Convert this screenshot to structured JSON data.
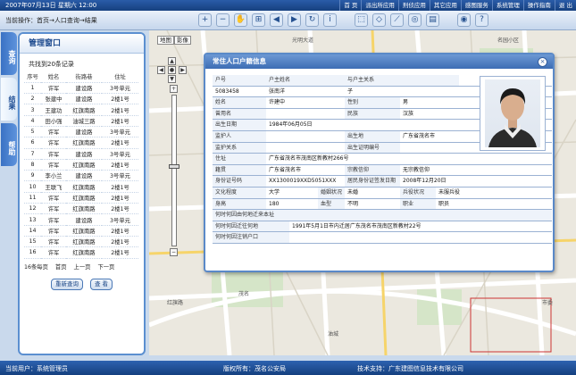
{
  "topbar": {
    "date": "2007年07月13日 星期六 12:00",
    "nav": [
      "首 页",
      "派出所应用",
      "刑侦应用",
      "其它应用",
      "感图服务",
      "系统管理",
      "操作指南",
      "退 出"
    ]
  },
  "toolbar": {
    "crumb": "当前操作：首页→人口查询→结果",
    "tools": [
      "zoom-in-icon",
      "zoom-out-icon",
      "pan-hand-icon",
      "full-extent-icon",
      "back-icon",
      "forward-icon",
      "refresh-icon",
      "info-icon",
      "select-icon",
      "erase-icon",
      "measure-icon",
      "locate-icon",
      "print-icon",
      "globe-icon",
      "help-icon"
    ]
  },
  "vtabs": [
    "查询",
    "结果",
    "帮助"
  ],
  "panel": {
    "title": "管理窗口",
    "count": "共找到20条记录",
    "columns": [
      "序号",
      "姓名",
      "街路巷",
      "住址"
    ],
    "rows": [
      [
        "1",
        "许军",
        "建设路",
        "3号单元"
      ],
      [
        "2",
        "张建中",
        "建设路",
        "2楼1号"
      ],
      [
        "3",
        "王建功",
        "红旗南路",
        "2楼1号"
      ],
      [
        "4",
        "田小强",
        "油城三路",
        "2楼1号"
      ],
      [
        "5",
        "许军",
        "建设路",
        "3号单元"
      ],
      [
        "6",
        "许军",
        "红旗南路",
        "2楼1号"
      ],
      [
        "7",
        "许军",
        "建设路",
        "3号单元"
      ],
      [
        "8",
        "许军",
        "红旗南路",
        "2楼1号"
      ],
      [
        "9",
        "李小兰",
        "建设路",
        "3号单元"
      ],
      [
        "10",
        "王联飞",
        "红旗南路",
        "2楼1号"
      ],
      [
        "11",
        "许军",
        "红旗南路",
        "2楼1号"
      ],
      [
        "12",
        "许军",
        "红旗南路",
        "2楼1号"
      ],
      [
        "13",
        "许军",
        "建设路",
        "3号单元"
      ],
      [
        "14",
        "许军",
        "红旗南路",
        "2楼1号"
      ],
      [
        "15",
        "许军",
        "红旗南路",
        "2楼1号"
      ],
      [
        "16",
        "许军",
        "红旗南路",
        "2楼1号"
      ]
    ],
    "pager": [
      "16条每页",
      "首页",
      "上一页",
      "下一页"
    ],
    "buttons": [
      "重新查询",
      "查 看"
    ]
  },
  "map": {
    "view_tabs": [
      "地图",
      "影像"
    ],
    "labels": [
      "光明大道",
      "名园小区",
      "红旗路",
      "油城",
      "市委",
      "茂名"
    ]
  },
  "popup": {
    "title": "常住人口户籍信息",
    "close": "×",
    "rows": [
      [
        [
          "户号",
          "label",
          60
        ],
        [
          "户主姓名",
          "label",
          88
        ],
        [
          "与户主关系",
          "label",
          128
        ]
      ],
      [
        [
          "5083458",
          "val",
          60
        ],
        [
          "张南洋",
          "val",
          88
        ],
        [
          "子",
          "val",
          128
        ]
      ],
      [
        [
          "姓名",
          "label",
          60
        ],
        [
          "许建中",
          "val",
          88
        ],
        [
          "性别",
          "label",
          62
        ],
        [
          "男",
          "val",
          66
        ]
      ],
      [
        [
          "曾用名",
          "label",
          60
        ],
        [
          "",
          "val",
          88
        ],
        [
          "民族",
          "label",
          62
        ],
        [
          "汉族",
          "val",
          66
        ]
      ],
      [
        [
          "出生日期",
          "label",
          60
        ],
        [
          "1984年06月05日",
          "val",
          216
        ]
      ],
      [
        [
          "监护人",
          "label",
          60
        ],
        [
          "",
          "val",
          88
        ],
        [
          "出生地",
          "label",
          62
        ],
        [
          "广东省茂名市",
          "val",
          66
        ]
      ],
      [
        [
          "监护关系",
          "label",
          60
        ],
        [
          "",
          "val",
          88
        ],
        [
          "出生证明编号",
          "label",
          62
        ],
        [
          "",
          "val",
          66
        ]
      ],
      [
        [
          "住址",
          "label",
          60
        ],
        [
          "广东省茂名市茂南区新教村266号",
          "val",
          216
        ]
      ],
      [
        [
          "籍贯",
          "label",
          60
        ],
        [
          "广东省茂名市",
          "val",
          88
        ],
        [
          "宗教信仰",
          "label",
          62
        ],
        [
          "无宗教信仰",
          "val",
          170
        ]
      ],
      [
        [
          "身份证号码",
          "label",
          60
        ],
        [
          "XX1300019XXD5051XXX",
          "val",
          88
        ],
        [
          "居民身份证签发日期",
          "label",
          62
        ],
        [
          "2008年12月20日",
          "val",
          170
        ]
      ],
      [
        [
          "文化程度",
          "label",
          60
        ],
        [
          "大学",
          "val",
          58
        ],
        [
          "婚姻状况",
          "label",
          30
        ],
        [
          "未婚",
          "val",
          62
        ],
        [
          "兵役状况",
          "label",
          40
        ],
        [
          "未服兵役",
          "val",
          130
        ]
      ],
      [
        [
          "身高",
          "label",
          60
        ],
        [
          "180",
          "val",
          58
        ],
        [
          "血型",
          "label",
          30
        ],
        [
          "不明",
          "val",
          62
        ],
        [
          "职业",
          "label",
          40
        ],
        [
          "职员",
          "val",
          130
        ]
      ],
      [
        [
          "何时何因由何地迁来本址",
          "label",
          380
        ]
      ],
      [
        [
          "何时何因迁往何地",
          "label",
          86
        ],
        [
          "1991年5月1日市内迁居广东茂名市茂南区新教村22号",
          "val",
          294
        ]
      ],
      [
        [
          "何时何因注销户口",
          "label",
          86
        ],
        [
          "",
          "val",
          294
        ]
      ]
    ]
  },
  "status": {
    "user": "当前用户：系统管理员",
    "copyright": "版权所有：茂名公安局",
    "support": "技术支持：广东建图信息技术有限公司"
  },
  "colors": {
    "nav": "#16407f",
    "panel_border": "#5b8fd0",
    "popup_title": "#3c6db4"
  }
}
